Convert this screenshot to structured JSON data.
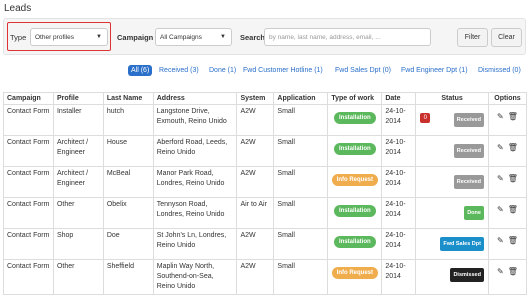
{
  "page": {
    "title": "Leads"
  },
  "filters": {
    "type_label": "Type",
    "type_value": "Other profiles",
    "campaign_label": "Campaign",
    "campaign_value": "All Campaigns",
    "search_label": "Search",
    "search_placeholder": "by name, last name, address, email, ...",
    "filter_button": "Filter",
    "clear_button": "Clear"
  },
  "tabs": [
    {
      "label": "All (6)",
      "active": true
    },
    {
      "label": "Received (3)"
    },
    {
      "label": "Done (1)"
    },
    {
      "label": "Fwd Customer Hotline (1)"
    },
    {
      "label": "Fwd Sales Dpt (0)"
    },
    {
      "label": "Fwd Engineer Dpt (1)"
    },
    {
      "label": "Dismissed (0)"
    }
  ],
  "table": {
    "headers": [
      "Campaign",
      "Profile",
      "Last Name",
      "Address",
      "System",
      "Application",
      "Type of work",
      "Date",
      "Status",
      "Options"
    ],
    "rows": [
      {
        "campaign": "Contact Form",
        "profile": "Installer",
        "last_name": "hutch",
        "address": "Langstone Drive, Exmouth, Reino Unido",
        "system": "A2W",
        "application": "Small",
        "work": "Installation",
        "date": "24-10-2014",
        "status": "Received",
        "alert": "0"
      },
      {
        "campaign": "Contact Form",
        "profile": "Architect / Engineer",
        "last_name": "House",
        "address": "Aberford Road, Leeds, Reino Unido",
        "system": "A2W",
        "application": "Small",
        "work": "Installation",
        "date": "24-10-2014",
        "status": "Received"
      },
      {
        "campaign": "Contact Form",
        "profile": "Architect / Engineer",
        "last_name": "McBeal",
        "address": "Manor Park Road, Londres, Reino Unido",
        "system": "A2W",
        "application": "Small",
        "work": "Info Request",
        "date": "24-10-2014",
        "status": "Received"
      },
      {
        "campaign": "Contact Form",
        "profile": "Other",
        "last_name": "Obelix",
        "address": "Tennyson Road, Londres, Reino Unido",
        "system": "Air to Air",
        "application": "Small",
        "work": "Installation",
        "date": "24-10-2014",
        "status": "Done"
      },
      {
        "campaign": "Contact Form",
        "profile": "Shop",
        "last_name": "Doe",
        "address": "St John's Ln, Londres, Reino Unido",
        "system": "A2W",
        "application": "Small",
        "work": "Installation",
        "date": "24-10-2014",
        "status": "Fwd Sales Dpt"
      },
      {
        "campaign": "Contact Form",
        "profile": "Other",
        "last_name": "Sheffield",
        "address": "Maplin Way North, Southend-on-Sea, Reino Unido",
        "system": "A2W",
        "application": "Small",
        "work": "Info Request",
        "date": "24-10-2014",
        "status": "Dismissed"
      }
    ]
  },
  "colors": {
    "Installation": "#5cb85c",
    "Info Request": "#f0ad4e",
    "Received": "#999999",
    "Done": "#5cb85c",
    "Fwd Sales Dpt": "#1a8fc9",
    "Dismissed": "#222222",
    "accent": "#2a6fc9"
  },
  "icons": {
    "edit": "edit-icon",
    "delete": "trash-icon"
  }
}
